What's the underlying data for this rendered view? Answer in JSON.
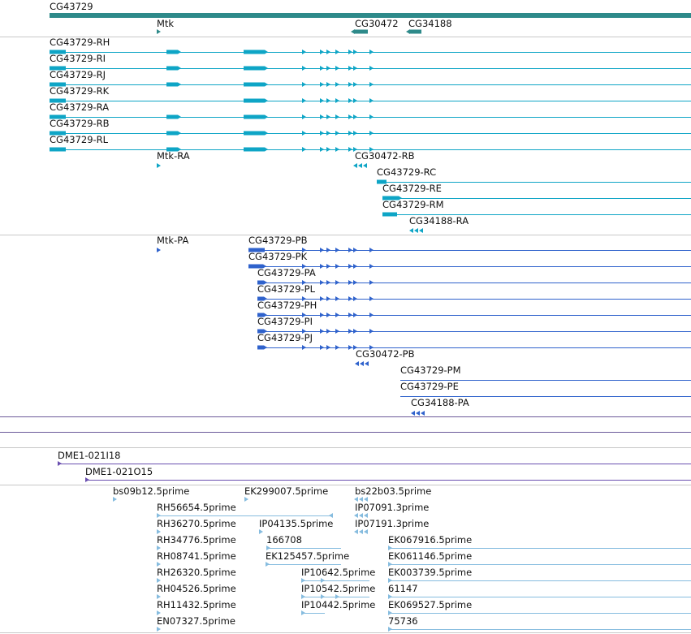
{
  "colors": {
    "gene": "#2e8a8a",
    "transcript": "#0ea5c6",
    "protein": "#2f62cc",
    "clone": "#6a4fb0",
    "est": "#86bcdf",
    "separator": "#c8c8c8",
    "text": "#111111"
  },
  "gene_track": {
    "genes": [
      "CG43729",
      "Mtk",
      "CG30472",
      "CG34188"
    ]
  },
  "transcript_track": {
    "transcripts": [
      "CG43729-RH",
      "CG43729-RI",
      "CG43729-RJ",
      "CG43729-RK",
      "CG43729-RA",
      "CG43729-RB",
      "CG43729-RL",
      "Mtk-RA",
      "CG30472-RB",
      "CG43729-RC",
      "CG43729-RE",
      "CG43729-RM",
      "CG34188-RA"
    ]
  },
  "protein_track": {
    "proteins": [
      "Mtk-PA",
      "CG43729-PB",
      "CG43729-PK",
      "CG43729-PA",
      "CG43729-PL",
      "CG43729-PH",
      "CG43729-PI",
      "CG43729-PJ",
      "CG30472-PB",
      "CG43729-PM",
      "CG43729-PE",
      "CG34188-PA"
    ]
  },
  "clone_track": {
    "clones": [
      "DME1-021I18",
      "DME1-021O15"
    ]
  },
  "est_track": {
    "ests": [
      "bs09b12.5prime",
      "EK299007.5prime",
      "bs22b03.5prime",
      "RH56654.5prime",
      "IP07091.3prime",
      "RH36270.5prime",
      "IP04135.5prime",
      "IP07191.3prime",
      "RH34776.5prime",
      "166708",
      "EK067916.5prime",
      "RH08741.5prime",
      "EK125457.5prime",
      "EK061146.5prime",
      "RH26320.5prime",
      "IP10642.5prime",
      "EK003739.5prime",
      "RH04526.5prime",
      "IP10542.5prime",
      "61147",
      "RH11432.5prime",
      "IP10442.5prime",
      "EK069527.5prime",
      "EN07327.5prime",
      "75736"
    ]
  }
}
